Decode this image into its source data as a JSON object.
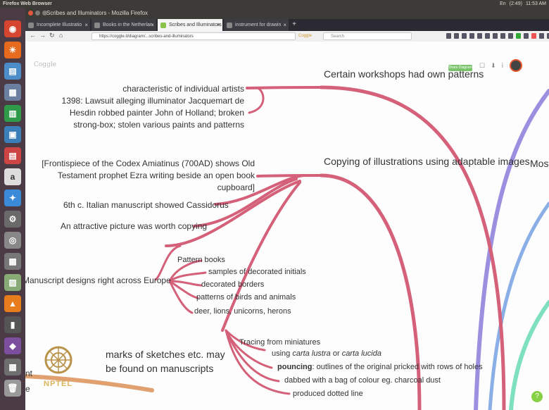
{
  "os": {
    "title": "Firefox Web Browser",
    "indicators": [
      "En",
      "(2:49)",
      "11:53 AM"
    ]
  },
  "window": {
    "title": "Scribes and Illuminators - Mozilla Firefox"
  },
  "tabs": [
    {
      "label": "Incomplete Illustratio",
      "active": false
    },
    {
      "label": "Books in the Netherlan",
      "active": false
    },
    {
      "label": "Scribes and Illuminators",
      "active": true
    },
    {
      "label": "instrument for drawin",
      "active": false
    }
  ],
  "nav": {
    "url": "https://coggle.it/diagram/...scribes-and-illuminators",
    "url_extra": "Coggle",
    "search_placeholder": "Search"
  },
  "app": {
    "logo": "Coggle",
    "share_label": "Share Diagram"
  },
  "mindmap": {
    "branch1": {
      "heading": "Certain workshops had own patterns",
      "items": [
        "characteristic of individual artists",
        "1398: Lawsuit alleging illuminator Jacquemart de",
        "Hesdin robbed painter John of Holland; broken",
        "strong-box; stolen various paints and patterns"
      ]
    },
    "branch2": {
      "heading": "Copying of illustrations using adaptable images",
      "items": [
        "[Frontispiece of the Codex Amiatinus (700AD) shows Old",
        "Testament prophet Ezra writing beside an open book",
        "cupboard]",
        "6th c. Italian manuscript showed Cassidorus",
        "An attractive picture was worth copying",
        "Manuscript designs right across Europe"
      ],
      "pattern_books": {
        "label": "Pattern books",
        "items": [
          "samples of decorated initials",
          "decorated borders",
          "patterns of birds and animals",
          "deer, lions, unicorns, herons"
        ]
      },
      "tracing": {
        "label": "Tracing from miniatures",
        "using_prefix": "using ",
        "using_a": "carta lustra",
        "using_or": " or ",
        "using_b": "carta lucida",
        "pouncing_bold": "pouncing",
        "pouncing_rest": ": outlines of the original pricked with rows of holes",
        "dabbed": "dabbed with a bag of colour eg. charcoal dust",
        "dotted": "produced dotted line"
      }
    },
    "branch3": {
      "heading_partial": "Most"
    },
    "branch4": {
      "lines": [
        "marks of sketches etc. may",
        "be found on manuscripts"
      ],
      "left_fragments": [
        "nt",
        "e"
      ]
    },
    "watermark": "NPTEL"
  },
  "colors": {
    "branch_pink": "#d4607a",
    "branch_purple": "#9b8fe0",
    "branch_blue": "#8aaee6",
    "branch_teal": "#7fe0c0",
    "branch_orange": "#e0a070"
  },
  "help_label": "?"
}
